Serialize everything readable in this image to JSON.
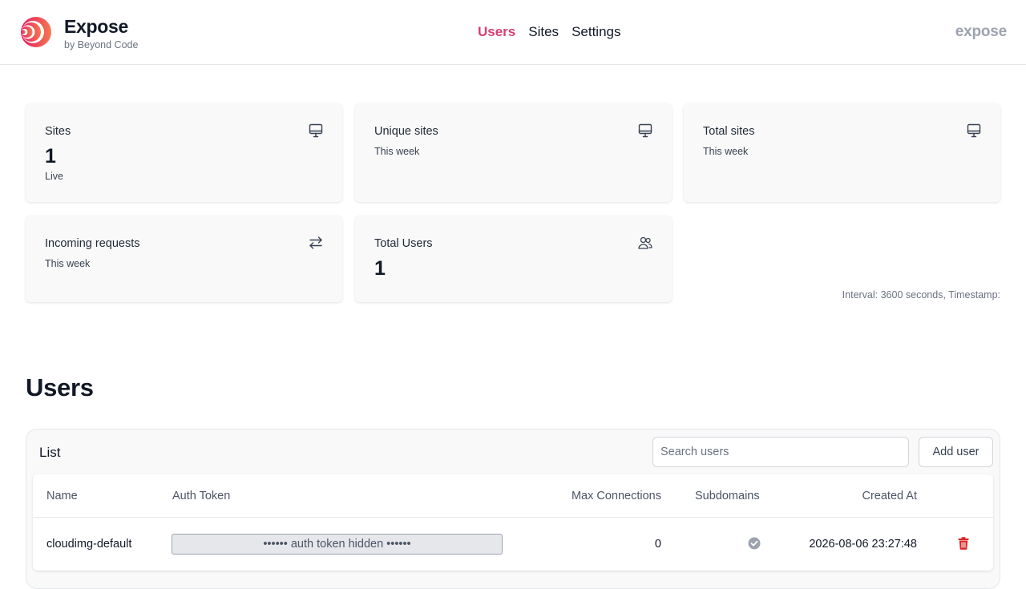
{
  "brand": {
    "name": "Expose",
    "byline": "by Beyond Code",
    "wordmark": "expose",
    "accent": "#d63f6f"
  },
  "nav": [
    {
      "label": "Users",
      "active": true
    },
    {
      "label": "Sites",
      "active": false
    },
    {
      "label": "Settings",
      "active": false
    }
  ],
  "stats": {
    "sites": {
      "title": "Sites",
      "value": "1",
      "sub": "Live",
      "icon": "monitor-icon"
    },
    "unique_sites": {
      "title": "Unique sites",
      "sub": "This week",
      "icon": "monitor-icon"
    },
    "total_sites": {
      "title": "Total sites",
      "sub": "This week",
      "icon": "monitor-icon"
    },
    "incoming_requests": {
      "title": "Incoming requests",
      "sub": "This week",
      "icon": "arrows-exchange-icon"
    },
    "total_users": {
      "title": "Total Users",
      "value": "1",
      "icon": "users-icon"
    }
  },
  "interval_text": "Interval: 3600 seconds, Timestamp:",
  "users": {
    "heading": "Users",
    "panel_title": "List",
    "search_placeholder": "Search users",
    "add_button": "Add user",
    "columns": [
      "Name",
      "Auth Token",
      "Max Connections",
      "Subdomains",
      "Created At"
    ],
    "rows": [
      {
        "name": "cloudimg-default",
        "auth_token": "•••••• auth token hidden ••••••",
        "max_connections": "0",
        "subdomains": "check-circle-icon",
        "created_at": "2026-08-06 23:27:48"
      }
    ]
  }
}
